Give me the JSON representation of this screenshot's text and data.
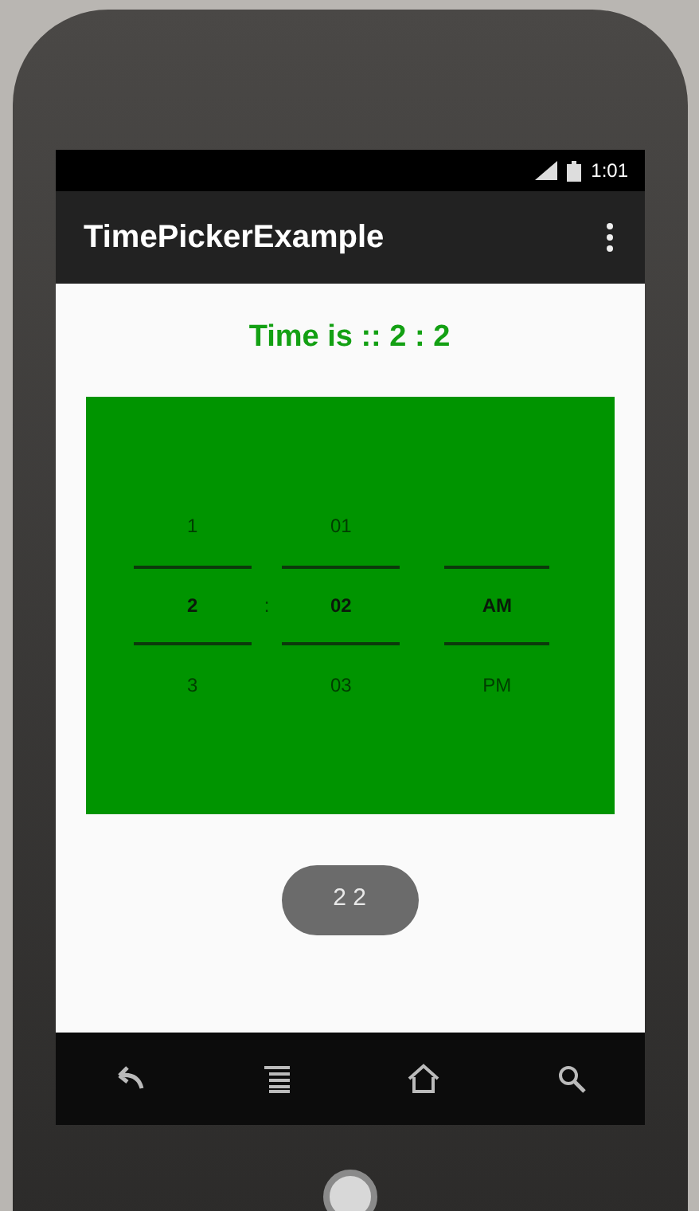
{
  "status_bar": {
    "time": "1:01"
  },
  "app_bar": {
    "title": "TimePickerExample"
  },
  "time_label": "Time is :: 2 : 2",
  "time_picker": {
    "separator": ":",
    "columns": [
      {
        "kind": "number",
        "values": [
          {
            "text": "1",
            "selected": false
          },
          {
            "text": "2",
            "selected": true
          },
          {
            "text": "3",
            "selected": false
          }
        ]
      },
      {
        "kind": "number",
        "values": [
          {
            "text": "01",
            "selected": false
          },
          {
            "text": "02",
            "selected": true
          },
          {
            "text": "03",
            "selected": false
          }
        ]
      },
      {
        "kind": "ampm",
        "values": [
          {
            "text": "AM",
            "selected": true
          },
          {
            "text": "PM",
            "selected": false
          }
        ]
      }
    ]
  },
  "button": {
    "label": "2 2"
  }
}
